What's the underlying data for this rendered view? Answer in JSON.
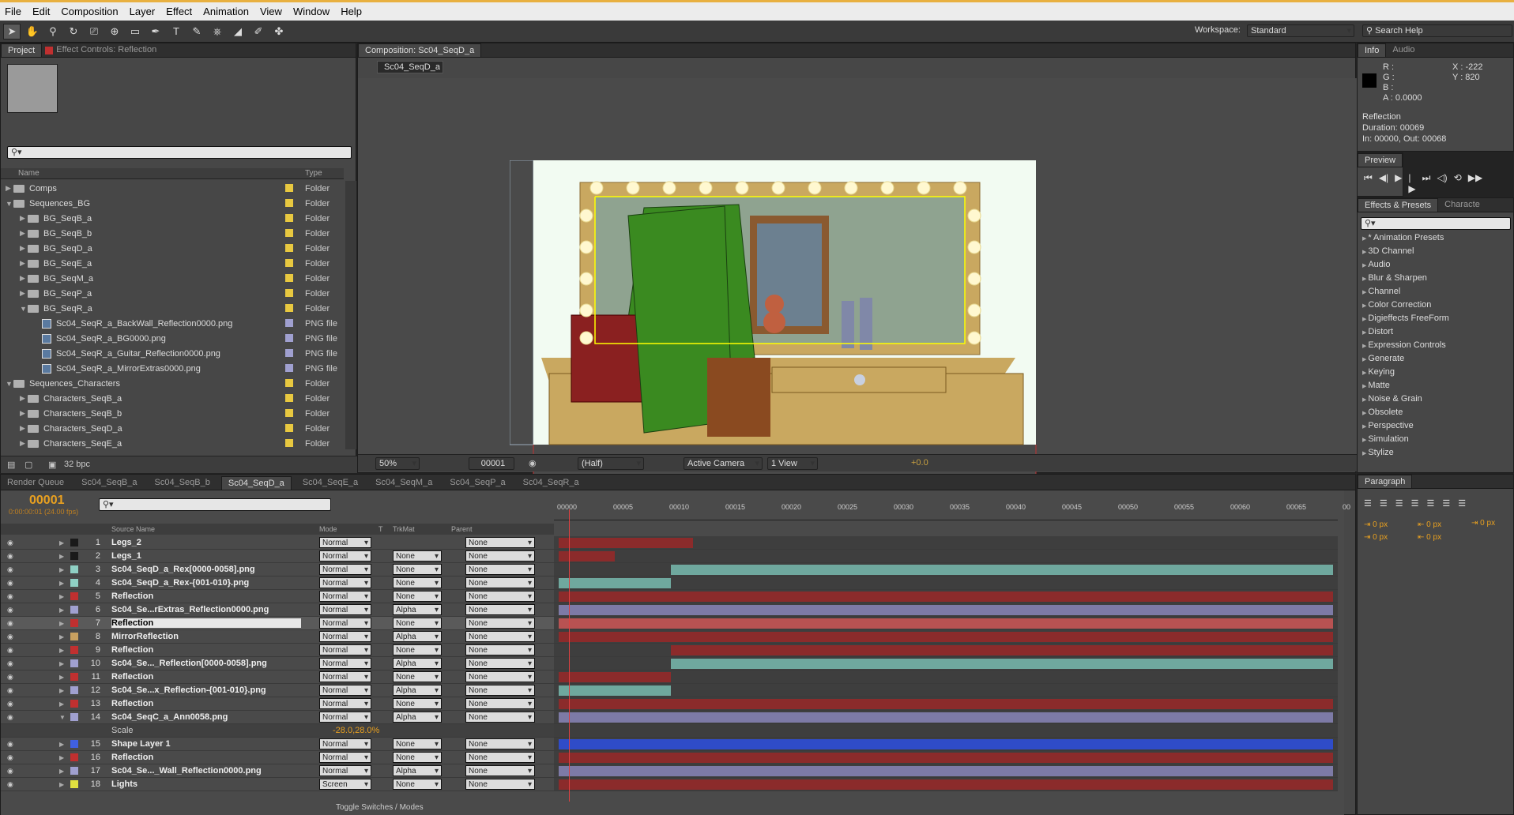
{
  "menu": [
    "File",
    "Edit",
    "Composition",
    "Layer",
    "Effect",
    "Animation",
    "View",
    "Window",
    "Help"
  ],
  "toolbar": {
    "workspace_label": "Workspace:",
    "workspace_value": "Standard",
    "search_help": "Search Help"
  },
  "project": {
    "tab_project": "Project",
    "tab_effect": "Effect Controls: Reflection",
    "col_name": "Name",
    "col_type": "Type",
    "bpc": "32 bpc",
    "items": [
      {
        "name": "Comps",
        "type": "Folder",
        "indent": 0,
        "kind": "folder",
        "open": false
      },
      {
        "name": "Sequences_BG",
        "type": "Folder",
        "indent": 0,
        "kind": "folder",
        "open": true
      },
      {
        "name": "BG_SeqB_a",
        "type": "Folder",
        "indent": 1,
        "kind": "folder",
        "open": false
      },
      {
        "name": "BG_SeqB_b",
        "type": "Folder",
        "indent": 1,
        "kind": "folder",
        "open": false
      },
      {
        "name": "BG_SeqD_a",
        "type": "Folder",
        "indent": 1,
        "kind": "folder",
        "open": false
      },
      {
        "name": "BG_SeqE_a",
        "type": "Folder",
        "indent": 1,
        "kind": "folder",
        "open": false
      },
      {
        "name": "BG_SeqM_a",
        "type": "Folder",
        "indent": 1,
        "kind": "folder",
        "open": false
      },
      {
        "name": "BG_SeqP_a",
        "type": "Folder",
        "indent": 1,
        "kind": "folder",
        "open": false
      },
      {
        "name": "BG_SeqR_a",
        "type": "Folder",
        "indent": 1,
        "kind": "folder",
        "open": true
      },
      {
        "name": "Sc04_SeqR_a_BackWall_Reflection0000.png",
        "type": "PNG file",
        "indent": 2,
        "kind": "png"
      },
      {
        "name": "Sc04_SeqR_a_BG0000.png",
        "type": "PNG file",
        "indent": 2,
        "kind": "png"
      },
      {
        "name": "Sc04_SeqR_a_Guitar_Reflection0000.png",
        "type": "PNG file",
        "indent": 2,
        "kind": "png"
      },
      {
        "name": "Sc04_SeqR_a_MirrorExtras0000.png",
        "type": "PNG file",
        "indent": 2,
        "kind": "png"
      },
      {
        "name": "Sequences_Characters",
        "type": "Folder",
        "indent": 0,
        "kind": "folder",
        "open": true
      },
      {
        "name": "Characters_SeqB_a",
        "type": "Folder",
        "indent": 1,
        "kind": "folder",
        "open": false
      },
      {
        "name": "Characters_SeqB_b",
        "type": "Folder",
        "indent": 1,
        "kind": "folder",
        "open": false
      },
      {
        "name": "Characters_SeqD_a",
        "type": "Folder",
        "indent": 1,
        "kind": "folder",
        "open": false
      },
      {
        "name": "Characters_SeqE_a",
        "type": "Folder",
        "indent": 1,
        "kind": "folder",
        "open": false
      }
    ]
  },
  "composition": {
    "tab": "Composition: Sc04_SeqD_a",
    "subtab": "Sc04_SeqD_a",
    "zoom": "50%",
    "frame": "00001",
    "resolution": "(Half)",
    "camera": "Active Camera",
    "views": "1 View",
    "exposure": "+0.0"
  },
  "info": {
    "tab_info": "Info",
    "tab_audio": "Audio",
    "r": "R :",
    "g": "G :",
    "b": "B :",
    "a": "A : 0.0000",
    "x": "X : -222",
    "y": "Y : 820",
    "layer": "Reflection",
    "duration": "Duration: 00069",
    "inout": "In: 00000, Out: 00068"
  },
  "preview": {
    "tab": "Preview"
  },
  "effects": {
    "tab": "Effects & Presets",
    "tab2": "Characte",
    "items": [
      "* Animation Presets",
      "3D Channel",
      "Audio",
      "Blur & Sharpen",
      "Channel",
      "Color Correction",
      "Digieffects FreeForm",
      "Distort",
      "Expression Controls",
      "Generate",
      "Keying",
      "Matte",
      "Noise & Grain",
      "Obsolete",
      "Perspective",
      "Simulation",
      "Stylize"
    ]
  },
  "paragraph": {
    "tab": "Paragraph",
    "v1": "0 px",
    "v2": "0 px",
    "v3": "0 px",
    "v4": "0 px",
    "v5": "0 px"
  },
  "timeline": {
    "tabs": [
      "Render Queue",
      "Sc04_SeqB_a",
      "Sc04_SeqB_b",
      "Sc04_SeqD_a",
      "Sc04_SeqE_a",
      "Sc04_SeqM_a",
      "Sc04_SeqP_a",
      "Sc04_SeqR_a"
    ],
    "active_tab": 3,
    "timecode": "00001",
    "fps": "0:00:00:01 (24.00 fps)",
    "col_source": "Source Name",
    "col_mode": "Mode",
    "col_t": "T",
    "col_trkmat": "TrkMat",
    "col_parent": "Parent",
    "ruler": [
      "00000",
      "00005",
      "00010",
      "00015",
      "00020",
      "00025",
      "00030",
      "00035",
      "00040",
      "00045",
      "00050",
      "00055",
      "00060",
      "00065",
      "00"
    ],
    "toggle": "Toggle Switches / Modes",
    "layers": [
      {
        "n": "1",
        "name": "Legs_2",
        "mode": "Normal",
        "trk": "",
        "parent": "None",
        "label": "#1a1a1a",
        "bar": "#8b2b2b",
        "start": 0,
        "end": 12
      },
      {
        "n": "2",
        "name": "Legs_1",
        "mode": "Normal",
        "trk": "None",
        "parent": "None",
        "label": "#1a1a1a",
        "bar": "#8b2b2b",
        "start": 0,
        "end": 5
      },
      {
        "n": "3",
        "name": "Sc04_SeqD_a_Rex[0000-0058].png",
        "mode": "Normal",
        "trk": "None",
        "parent": "None",
        "label": "#8fd0c4",
        "bar": "#6fa89e",
        "start": 10,
        "end": 69
      },
      {
        "n": "4",
        "name": "Sc04_SeqD_a_Rex-{001-010}.png",
        "mode": "Normal",
        "trk": "None",
        "parent": "None",
        "label": "#8fd0c4",
        "bar": "#6fa89e",
        "start": 0,
        "end": 10
      },
      {
        "n": "5",
        "name": "Reflection",
        "mode": "Normal",
        "trk": "None",
        "parent": "None",
        "label": "#c03030",
        "bar": "#8b2b2b",
        "start": 0,
        "end": 69
      },
      {
        "n": "6",
        "name": "Sc04_Se...rExtras_Reflection0000.png",
        "mode": "Normal",
        "trk": "Alpha",
        "parent": "None",
        "label": "#a0a0d0",
        "bar": "#7d7aa6",
        "start": 0,
        "end": 69
      },
      {
        "n": "7",
        "name": "Reflection",
        "mode": "Normal",
        "trk": "None",
        "parent": "None",
        "label": "#c03030",
        "bar": "#b85252",
        "start": 0,
        "end": 69,
        "sel": true
      },
      {
        "n": "8",
        "name": "MirrorReflection",
        "mode": "Normal",
        "trk": "Alpha",
        "parent": "None",
        "label": "#c8a060",
        "bar": "#8b2b2b",
        "start": 0,
        "end": 69
      },
      {
        "n": "9",
        "name": "Reflection",
        "mode": "Normal",
        "trk": "None",
        "parent": "None",
        "label": "#c03030",
        "bar": "#8b2b2b",
        "start": 10,
        "end": 69
      },
      {
        "n": "10",
        "name": "Sc04_Se..._Reflection[0000-0058].png",
        "mode": "Normal",
        "trk": "Alpha",
        "parent": "None",
        "label": "#a0a0d0",
        "bar": "#6fa89e",
        "start": 10,
        "end": 69
      },
      {
        "n": "11",
        "name": "Reflection",
        "mode": "Normal",
        "trk": "None",
        "parent": "None",
        "label": "#c03030",
        "bar": "#8b2b2b",
        "start": 0,
        "end": 10
      },
      {
        "n": "12",
        "name": "Sc04_Se...x_Reflection-{001-010}.png",
        "mode": "Normal",
        "trk": "Alpha",
        "parent": "None",
        "label": "#a0a0d0",
        "bar": "#6fa89e",
        "start": 0,
        "end": 10
      },
      {
        "n": "13",
        "name": "Reflection",
        "mode": "Normal",
        "trk": "None",
        "parent": "None",
        "label": "#c03030",
        "bar": "#8b2b2b",
        "start": 0,
        "end": 69
      },
      {
        "n": "14",
        "name": "Sc04_SeqC_a_Ann0058.png",
        "mode": "Normal",
        "trk": "Alpha",
        "parent": "None",
        "label": "#a0a0d0",
        "bar": "#7d7aa6",
        "start": 0,
        "end": 69,
        "open": true
      },
      {
        "sub": true,
        "name": "Scale",
        "value": "-28.0,28.0%"
      },
      {
        "n": "15",
        "name": "Shape Layer 1",
        "mode": "Normal",
        "trk": "None",
        "parent": "None",
        "label": "#4060e0",
        "bar": "#2f4cc8",
        "start": 0,
        "end": 69
      },
      {
        "n": "16",
        "name": "Reflection",
        "mode": "Normal",
        "trk": "None",
        "parent": "None",
        "label": "#c03030",
        "bar": "#8b2b2b",
        "start": 0,
        "end": 69
      },
      {
        "n": "17",
        "name": "Sc04_Se..._Wall_Reflection0000.png",
        "mode": "Normal",
        "trk": "Alpha",
        "parent": "None",
        "label": "#a0a0d0",
        "bar": "#7d7aa6",
        "start": 0,
        "end": 69
      },
      {
        "n": "18",
        "name": "Lights",
        "mode": "Screen",
        "trk": "None",
        "parent": "None",
        "label": "#e0e040",
        "bar": "#8b2b2b",
        "start": 0,
        "end": 69
      }
    ]
  }
}
